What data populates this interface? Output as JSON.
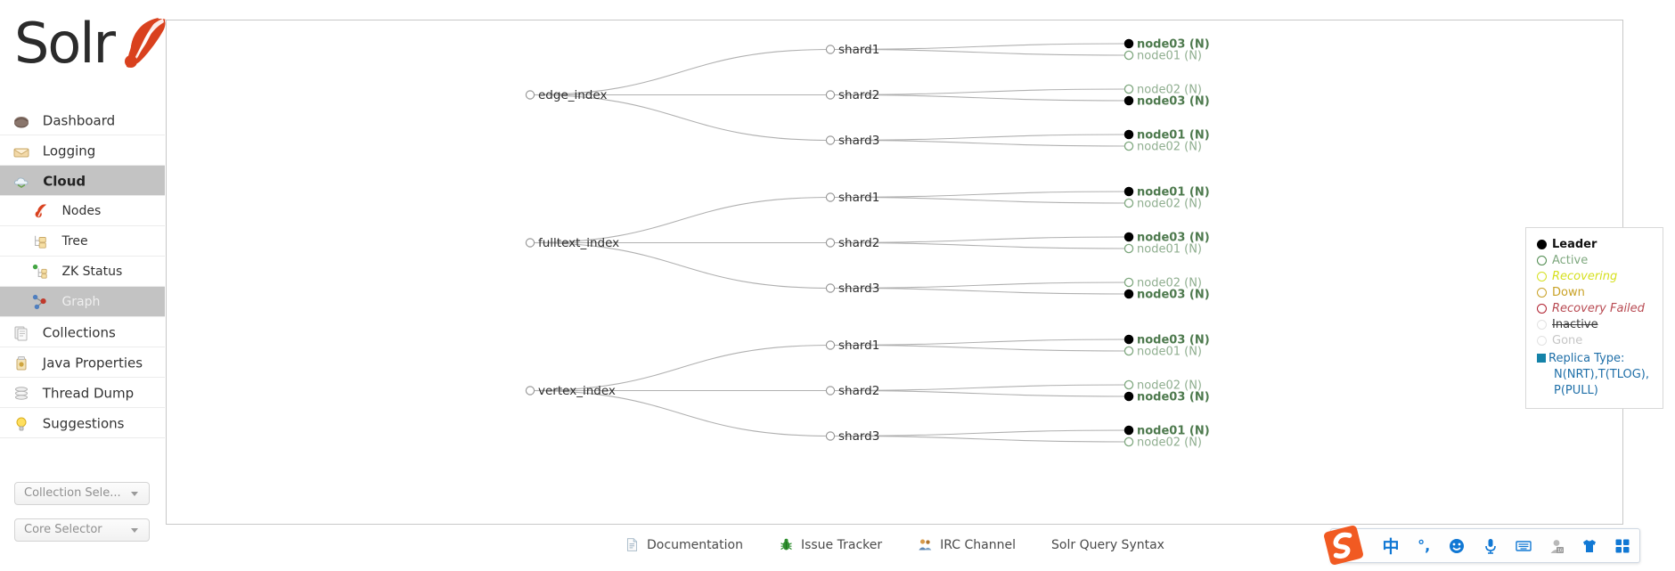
{
  "app": {
    "logo_text": "Solr",
    "logo_icon": "solr-burst-icon"
  },
  "sidebar": {
    "items": [
      {
        "label": "Dashboard",
        "icon": "dashboard-icon",
        "active": false,
        "sub": false
      },
      {
        "label": "Logging",
        "icon": "logging-icon",
        "active": false,
        "sub": false
      },
      {
        "label": "Cloud",
        "icon": "cloud-icon",
        "active": true,
        "sub": false
      },
      {
        "label": "Nodes",
        "icon": "nodes-icon",
        "active": false,
        "sub": true
      },
      {
        "label": "Tree",
        "icon": "tree-icon",
        "active": false,
        "sub": true
      },
      {
        "label": "ZK Status",
        "icon": "zk-status-icon",
        "active": false,
        "sub": true
      },
      {
        "label": "Graph",
        "icon": "graph-icon",
        "active": true,
        "sub": true
      },
      {
        "label": "Collections",
        "icon": "collections-icon",
        "active": false,
        "sub": false
      },
      {
        "label": "Java Properties",
        "icon": "java-icon",
        "active": false,
        "sub": false
      },
      {
        "label": "Thread Dump",
        "icon": "thread-icon",
        "active": false,
        "sub": false
      },
      {
        "label": "Suggestions",
        "icon": "bulb-icon",
        "active": false,
        "sub": false
      }
    ],
    "collection_selector": {
      "label": "Collection Sele...",
      "icon": "chevron-down-icon"
    },
    "core_selector": {
      "label": "Core Selector",
      "icon": "chevron-down-icon"
    }
  },
  "graph": {
    "collections": [
      {
        "name": "edge_index",
        "shards": [
          {
            "name": "shard1",
            "replicas": [
              {
                "label": "node03 (N)",
                "state": "leader"
              },
              {
                "label": "node01 (N)",
                "state": "active"
              }
            ]
          },
          {
            "name": "shard2",
            "replicas": [
              {
                "label": "node02 (N)",
                "state": "active"
              },
              {
                "label": "node03 (N)",
                "state": "leader"
              }
            ]
          },
          {
            "name": "shard3",
            "replicas": [
              {
                "label": "node01 (N)",
                "state": "leader"
              },
              {
                "label": "node02 (N)",
                "state": "active"
              }
            ]
          }
        ]
      },
      {
        "name": "fulltext_index",
        "shards": [
          {
            "name": "shard1",
            "replicas": [
              {
                "label": "node01 (N)",
                "state": "leader"
              },
              {
                "label": "node02 (N)",
                "state": "active"
              }
            ]
          },
          {
            "name": "shard2",
            "replicas": [
              {
                "label": "node03 (N)",
                "state": "leader"
              },
              {
                "label": "node01 (N)",
                "state": "active"
              }
            ]
          },
          {
            "name": "shard3",
            "replicas": [
              {
                "label": "node02 (N)",
                "state": "active"
              },
              {
                "label": "node03 (N)",
                "state": "leader"
              }
            ]
          }
        ]
      },
      {
        "name": "vertex_index",
        "shards": [
          {
            "name": "shard1",
            "replicas": [
              {
                "label": "node03 (N)",
                "state": "leader"
              },
              {
                "label": "node01 (N)",
                "state": "active"
              }
            ]
          },
          {
            "name": "shard2",
            "replicas": [
              {
                "label": "node02 (N)",
                "state": "active"
              },
              {
                "label": "node03 (N)",
                "state": "leader"
              }
            ]
          },
          {
            "name": "shard3",
            "replicas": [
              {
                "label": "node01 (N)",
                "state": "leader"
              },
              {
                "label": "node02 (N)",
                "state": "active"
              }
            ]
          }
        ]
      }
    ],
    "colors": {
      "link": "#b0b0b0",
      "node_ring": "#9a9a9a",
      "leader_fill": "#000000",
      "leader_text": "#4e7a4e",
      "active_ring": "#7fa87f",
      "active_text": "#8fae8f"
    }
  },
  "legend": {
    "rows": [
      {
        "label": "Leader",
        "shape": "filled-circle",
        "color": "#000000",
        "text_color": "#111111",
        "bold": true,
        "italic": false,
        "strike": false
      },
      {
        "label": "Active",
        "shape": "ring",
        "color": "#4e8a4e",
        "text_color": "#7fa87f",
        "bold": false,
        "italic": false,
        "strike": false
      },
      {
        "label": "Recovering",
        "shape": "ring",
        "color": "#d6e020",
        "text_color": "#d6e020",
        "bold": false,
        "italic": true,
        "strike": false
      },
      {
        "label": "Down",
        "shape": "ring",
        "color": "#c9a227",
        "text_color": "#c9a227",
        "bold": false,
        "italic": false,
        "strike": false
      },
      {
        "label": "Recovery Failed",
        "shape": "ring",
        "color": "#b0202f",
        "text_color": "#b84a52",
        "bold": false,
        "italic": true,
        "strike": false
      },
      {
        "label": "Inactive",
        "shape": "ring",
        "color": "#e2e2e2",
        "text_color": "#3a3a3a",
        "bold": false,
        "italic": false,
        "strike": true
      },
      {
        "label": "Gone",
        "shape": "ring",
        "color": "#e2e2e2",
        "text_color": "#c6c6c6",
        "bold": false,
        "italic": false,
        "strike": false
      }
    ],
    "replica_type": {
      "label": "Replica Type:",
      "detail_line1": "N(NRT),T(TLOG),",
      "detail_line2": "P(PULL)",
      "swatch_color": "#1482a8",
      "text_color": "#1f6fa8"
    }
  },
  "footer": {
    "links": [
      {
        "label": "Documentation",
        "icon": "document-icon"
      },
      {
        "label": "Issue Tracker",
        "icon": "bug-icon"
      },
      {
        "label": "IRC Channel",
        "icon": "people-icon"
      },
      {
        "label": "Solr Query Syntax",
        "icon": "none"
      }
    ]
  },
  "ime": {
    "name": "sogou-ime-toolbar",
    "logo": "sogou-logo-icon",
    "buttons": [
      {
        "name": "chinese-mode-button",
        "glyph": "中"
      },
      {
        "name": "punctuation-button",
        "glyph": "°,"
      },
      {
        "name": "emoji-button",
        "glyph": "☺"
      },
      {
        "name": "voice-input-button",
        "glyph": "mic"
      },
      {
        "name": "soft-keyboard-button",
        "glyph": "keyboard"
      },
      {
        "name": "user-account-button",
        "glyph": "user"
      },
      {
        "name": "skin-button",
        "glyph": "shirt"
      },
      {
        "name": "toolbox-button",
        "glyph": "grid"
      }
    ]
  }
}
